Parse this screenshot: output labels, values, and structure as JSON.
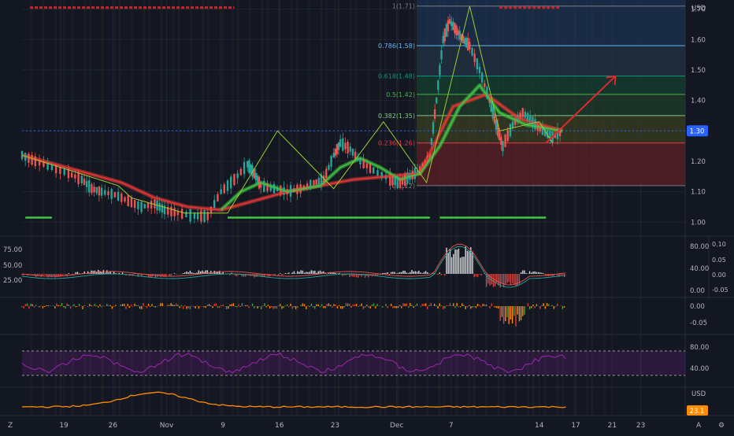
{
  "colors": {
    "bg": "#131722",
    "grid": "#1f2433",
    "axis_text": "#b2b5be",
    "price_tag": "#2962ff",
    "red_ma": "#e53935",
    "green_ma": "#43c743",
    "zigzag": "#9acd32",
    "arrow": "#e0282e",
    "purple": "#9c27b0",
    "orange": "#ff8c00"
  },
  "header": {
    "currency": "USD",
    "price_tag": "1.30"
  },
  "chart_data": [
    {
      "type": "candlestick",
      "ylim": [
        0.98,
        1.73
      ],
      "y_ticks": [
        1.0,
        1.1,
        1.2,
        1.3,
        1.4,
        1.5,
        1.6,
        1.7
      ],
      "y_tick_labels": [
        "1.00",
        "1.10",
        "1.20",
        "1.30",
        "1.40",
        "1.50",
        "1.60",
        "1.70"
      ],
      "x_ticks": [
        {
          "label": "19",
          "pos": 0.063
        },
        {
          "label": "26",
          "pos": 0.137
        },
        {
          "label": "Nov",
          "pos": 0.218
        },
        {
          "label": "9",
          "pos": 0.303
        },
        {
          "label": "16",
          "pos": 0.388
        },
        {
          "label": "23",
          "pos": 0.472
        },
        {
          "label": "Dec",
          "pos": 0.565
        },
        {
          "label": "7",
          "pos": 0.647
        },
        {
          "label": "14",
          "pos": 0.78
        },
        {
          "label": "17",
          "pos": 0.835
        },
        {
          "label": "21",
          "pos": 0.89
        },
        {
          "label": "23",
          "pos": 0.933
        }
      ],
      "price_path": [
        [
          0.0,
          1.22
        ],
        [
          0.02,
          1.2
        ],
        [
          0.045,
          1.18
        ],
        [
          0.07,
          1.16
        ],
        [
          0.09,
          1.14
        ],
        [
          0.105,
          1.11
        ],
        [
          0.12,
          1.1
        ],
        [
          0.14,
          1.09
        ],
        [
          0.16,
          1.07
        ],
        [
          0.18,
          1.05
        ],
        [
          0.2,
          1.06
        ],
        [
          0.215,
          1.04
        ],
        [
          0.235,
          1.03
        ],
        [
          0.26,
          1.02
        ],
        [
          0.28,
          1.02
        ],
        [
          0.3,
          1.1
        ],
        [
          0.32,
          1.14
        ],
        [
          0.34,
          1.19
        ],
        [
          0.35,
          1.16
        ],
        [
          0.36,
          1.12
        ],
        [
          0.38,
          1.11
        ],
        [
          0.4,
          1.1
        ],
        [
          0.42,
          1.11
        ],
        [
          0.44,
          1.13
        ],
        [
          0.455,
          1.14
        ],
        [
          0.47,
          1.22
        ],
        [
          0.48,
          1.26
        ],
        [
          0.495,
          1.24
        ],
        [
          0.51,
          1.2
        ],
        [
          0.53,
          1.17
        ],
        [
          0.555,
          1.14
        ],
        [
          0.57,
          1.13
        ],
        [
          0.585,
          1.15
        ],
        [
          0.6,
          1.17
        ],
        [
          0.615,
          1.22
        ],
        [
          0.625,
          1.4
        ],
        [
          0.635,
          1.6
        ],
        [
          0.645,
          1.66
        ],
        [
          0.655,
          1.63
        ],
        [
          0.665,
          1.6
        ],
        [
          0.675,
          1.58
        ],
        [
          0.69,
          1.5
        ],
        [
          0.705,
          1.4
        ],
        [
          0.715,
          1.32
        ],
        [
          0.725,
          1.25
        ],
        [
          0.74,
          1.32
        ],
        [
          0.755,
          1.36
        ],
        [
          0.77,
          1.33
        ],
        [
          0.785,
          1.3
        ],
        [
          0.8,
          1.28
        ],
        [
          0.815,
          1.3
        ]
      ],
      "red_ma": [
        [
          0.0,
          1.22
        ],
        [
          0.05,
          1.19
        ],
        [
          0.1,
          1.16
        ],
        [
          0.15,
          1.13
        ],
        [
          0.2,
          1.08
        ],
        [
          0.25,
          1.05
        ],
        [
          0.3,
          1.04
        ],
        [
          0.35,
          1.07
        ],
        [
          0.4,
          1.1
        ],
        [
          0.45,
          1.12
        ],
        [
          0.5,
          1.14
        ],
        [
          0.55,
          1.15
        ],
        [
          0.6,
          1.16
        ],
        [
          0.65,
          1.38
        ],
        [
          0.7,
          1.42
        ],
        [
          0.75,
          1.34
        ],
        [
          0.815,
          1.3
        ]
      ],
      "green_ma": [
        [
          0.3,
          1.04
        ],
        [
          0.33,
          1.1
        ],
        [
          0.36,
          1.13
        ],
        [
          0.4,
          1.1
        ],
        [
          0.45,
          1.12
        ],
        [
          0.48,
          1.18
        ],
        [
          0.51,
          1.21
        ],
        [
          0.54,
          1.18
        ],
        [
          0.57,
          1.14
        ],
        [
          0.6,
          1.16
        ],
        [
          0.63,
          1.25
        ],
        [
          0.66,
          1.38
        ],
        [
          0.69,
          1.45
        ],
        [
          0.72,
          1.36
        ],
        [
          0.76,
          1.32
        ],
        [
          0.815,
          1.3
        ]
      ],
      "zigzag": [
        [
          0.0,
          1.22
        ],
        [
          0.145,
          1.12
        ],
        [
          0.165,
          1.08
        ],
        [
          0.245,
          1.03
        ],
        [
          0.31,
          1.03
        ],
        [
          0.385,
          1.3
        ],
        [
          0.47,
          1.11
        ],
        [
          0.545,
          1.33
        ],
        [
          0.61,
          1.13
        ],
        [
          0.675,
          1.71
        ],
        [
          0.72,
          1.3
        ],
        [
          0.78,
          1.33
        ],
        [
          0.8,
          1.26
        ]
      ],
      "fib_levels": [
        {
          "label": "0(1.12)",
          "value": 1.12,
          "color": "#787b86"
        },
        {
          "label": "0.236(1.26)",
          "value": 1.26,
          "color": "#f23645"
        },
        {
          "label": "0.382(1.35)",
          "value": 1.35,
          "color": "#81c784"
        },
        {
          "label": "0.5(1.42)",
          "value": 1.42,
          "color": "#4caf50"
        },
        {
          "label": "0.618(1.48)",
          "value": 1.48,
          "color": "#089981"
        },
        {
          "label": "0.786(1.58)",
          "value": 1.58,
          "color": "#64b5f6"
        },
        {
          "label": "1(1.71)",
          "value": 1.71,
          "color": "#787b86"
        }
      ],
      "current_price": 1.3
    },
    {
      "type": "line",
      "name": "oscillator",
      "left_ticks": [
        "75.00",
        "50.00",
        "25.00"
      ],
      "right_ticks": [
        "80.00",
        "40.00",
        "0.00"
      ],
      "far_right_ticks": [
        "0.10",
        "0.05",
        "0.00",
        "-0.05"
      ]
    },
    {
      "type": "bar",
      "name": "histogram",
      "right_ticks": [
        "0.00",
        "-0.05"
      ]
    },
    {
      "type": "line",
      "name": "rsi",
      "right_ticks": [
        "80.00",
        "40.00"
      ]
    },
    {
      "type": "line",
      "name": "volatility",
      "currency": "USD",
      "value_tag": "23.1"
    }
  ],
  "bottom_bar": {
    "left": "Z",
    "right_a": "A",
    "right_gear": "⚙"
  }
}
